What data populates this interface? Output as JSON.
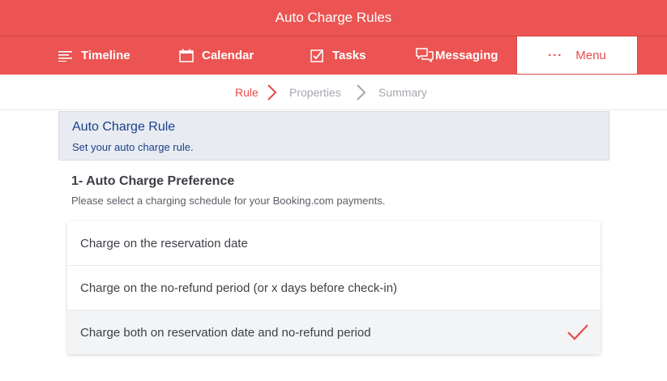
{
  "app": {
    "title": "Auto Charge Rules"
  },
  "nav": {
    "items": [
      {
        "label": "Timeline",
        "icon": "timeline-icon"
      },
      {
        "label": "Calendar",
        "icon": "calendar-icon"
      },
      {
        "label": "Tasks",
        "icon": "tasks-icon"
      },
      {
        "label": "Messaging",
        "icon": "messaging-icon"
      },
      {
        "label": "Menu",
        "icon": "more-dots-icon",
        "glyph": "···"
      }
    ],
    "active": "Menu"
  },
  "steps": {
    "items": [
      "Rule",
      "Properties",
      "Summary"
    ],
    "current": "Rule"
  },
  "panel": {
    "title": "Auto Charge Rule",
    "subtitle": "Set your auto charge rule."
  },
  "section": {
    "title": "1- Auto Charge Preference",
    "description": "Please select a charging schedule for your Booking.com payments."
  },
  "options": [
    {
      "label": "Charge on the reservation date",
      "selected": false
    },
    {
      "label": "Charge on the no-refund period (or x days before check-in)",
      "selected": false
    },
    {
      "label": "Charge both on reservation date and no-refund period",
      "selected": true
    }
  ],
  "colors": {
    "brand": "#eb5452",
    "panel_bg": "#e8ecf2",
    "panel_text": "#1b3f8a",
    "check": "#e84a4a"
  }
}
